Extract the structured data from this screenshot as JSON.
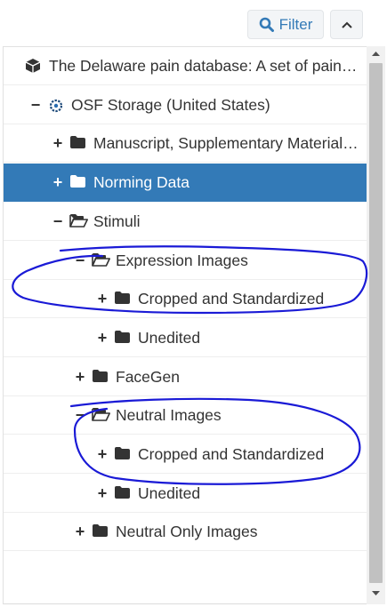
{
  "toolbar": {
    "filter_label": "Filter",
    "search_icon": "search-icon",
    "collapse_icon": "chevron-up-icon"
  },
  "tree": {
    "rows": [
      {
        "label": "The Delaware pain database: A set of pain expressions and corresponding norming data",
        "toggle": "",
        "icon": "cube-icon",
        "depth": 0,
        "selected": false
      },
      {
        "label": "OSF Storage (United States)",
        "toggle": "−",
        "icon": "storage-icon",
        "depth": 1,
        "selected": false
      },
      {
        "label": "Manuscript, Supplementary Materials and Code",
        "toggle": "+",
        "icon": "folder-icon",
        "depth": 2,
        "selected": false
      },
      {
        "label": "Norming Data",
        "toggle": "+",
        "icon": "folder-icon",
        "depth": 2,
        "selected": true
      },
      {
        "label": "Stimuli",
        "toggle": "−",
        "icon": "folder-open-icon",
        "depth": 2,
        "selected": false
      },
      {
        "label": "Expression Images",
        "toggle": "−",
        "icon": "folder-open-icon",
        "depth": 3,
        "selected": false
      },
      {
        "label": "Cropped and Standardized",
        "toggle": "+",
        "icon": "folder-icon",
        "depth": 4,
        "selected": false
      },
      {
        "label": "Unedited",
        "toggle": "+",
        "icon": "folder-icon",
        "depth": 4,
        "selected": false
      },
      {
        "label": "FaceGen",
        "toggle": "+",
        "icon": "folder-icon",
        "depth": 3,
        "selected": false
      },
      {
        "label": "Neutral Images",
        "toggle": "−",
        "icon": "folder-open-icon",
        "depth": 3,
        "selected": false
      },
      {
        "label": "Cropped and Standardized",
        "toggle": "+",
        "icon": "folder-icon",
        "depth": 4,
        "selected": false
      },
      {
        "label": "Unedited",
        "toggle": "+",
        "icon": "folder-icon",
        "depth": 4,
        "selected": false
      },
      {
        "label": "Neutral Only Images",
        "toggle": "+",
        "icon": "folder-icon",
        "depth": 3,
        "selected": false
      }
    ]
  },
  "colors": {
    "accent": "#337ab7",
    "annotation": "#1a1ad6",
    "text": "#333333",
    "folder": "#333333"
  }
}
